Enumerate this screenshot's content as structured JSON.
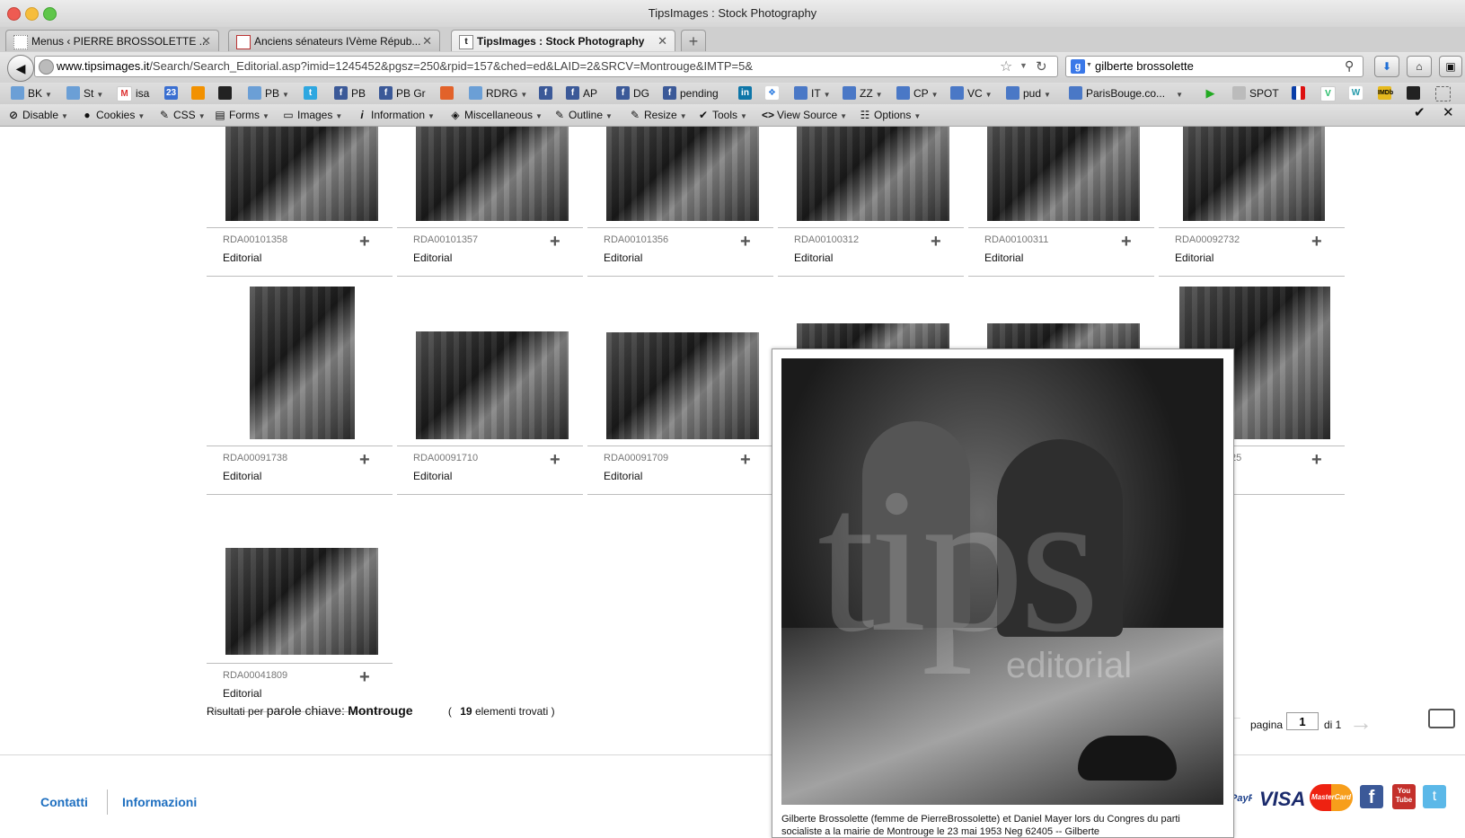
{
  "window": {
    "title": "TipsImages : Stock Photography"
  },
  "tabs": [
    {
      "label": "Menus ‹ PIERRE BROSSOLETTE ..."
    },
    {
      "label": "Anciens sénateurs IVème Répub..."
    },
    {
      "label": "TipsImages : Stock Photography"
    }
  ],
  "nav": {
    "url_host": "www.tipsimages.it",
    "url_path": "/Search/Search_Editorial.asp?imid=1245452&pgsz=250&rpid=157&ched=ed&LAID=2&SRCV=Montrouge&IMTP=5&",
    "search_value": "gilberte brossolette"
  },
  "bookmarks": [
    {
      "label": "BK"
    },
    {
      "label": "St"
    },
    {
      "label": "isa"
    },
    {
      "label": "PB"
    },
    {
      "label": "PB"
    },
    {
      "label": "PB Gr"
    },
    {
      "label": "RDRG"
    },
    {
      "label": "AP"
    },
    {
      "label": "DG"
    },
    {
      "label": "pending"
    },
    {
      "label": "IT"
    },
    {
      "label": "ZZ"
    },
    {
      "label": "CP"
    },
    {
      "label": "VC"
    },
    {
      "label": "pud"
    },
    {
      "label": "ParisBouge.co..."
    },
    {
      "label": "SPOT"
    }
  ],
  "devtools": [
    {
      "label": "Disable"
    },
    {
      "label": "Cookies"
    },
    {
      "label": "CSS"
    },
    {
      "label": "Forms"
    },
    {
      "label": "Images"
    },
    {
      "label": "Information"
    },
    {
      "label": "Miscellaneous"
    },
    {
      "label": "Outline"
    },
    {
      "label": "Resize"
    },
    {
      "label": "Tools"
    },
    {
      "label": "View Source"
    },
    {
      "label": "Options"
    }
  ],
  "grid": [
    {
      "code": "RDA00101358",
      "tag": "Editorial"
    },
    {
      "code": "RDA00101357",
      "tag": "Editorial"
    },
    {
      "code": "RDA00101356",
      "tag": "Editorial"
    },
    {
      "code": "RDA00100312",
      "tag": "Editorial"
    },
    {
      "code": "RDA00100311",
      "tag": "Editorial"
    },
    {
      "code": "RDA00092732",
      "tag": "Editorial"
    },
    {
      "code": "RDA00091738",
      "tag": "Editorial"
    },
    {
      "code": "RDA00091710",
      "tag": "Editorial"
    },
    {
      "code": "RDA00091709",
      "tag": "Editorial"
    },
    {
      "code": "25",
      "tag": ""
    },
    {
      "code": "RDA00041809",
      "tag": "Editorial"
    }
  ],
  "results": {
    "prefix": "Risultati per",
    "kw_label": "parole chiave:",
    "keyword": "Montrouge",
    "count": "19",
    "count_suffix": "elementi trovati"
  },
  "pager": {
    "label": "pagina",
    "value": "1",
    "of": "di 1"
  },
  "popup": {
    "watermark": "tips",
    "watermark_sub": "editorial",
    "caption": "Gilberte Brossolette (femme de PierreBrossolette) et Daniel Mayer lors du Congres du parti socialiste a la mairie de Montrouge le 23 mai 1953 Neg 62405 -- Gilberte"
  },
  "footer": {
    "links": [
      {
        "label": "Contatti"
      },
      {
        "label": "Informazioni"
      }
    ],
    "payments": [
      {
        "label": "PayPal"
      },
      {
        "label": "VISA"
      },
      {
        "label": "MasterCard"
      }
    ],
    "social": [
      {
        "label": "f"
      },
      {
        "label": "You Tube"
      }
    ]
  }
}
